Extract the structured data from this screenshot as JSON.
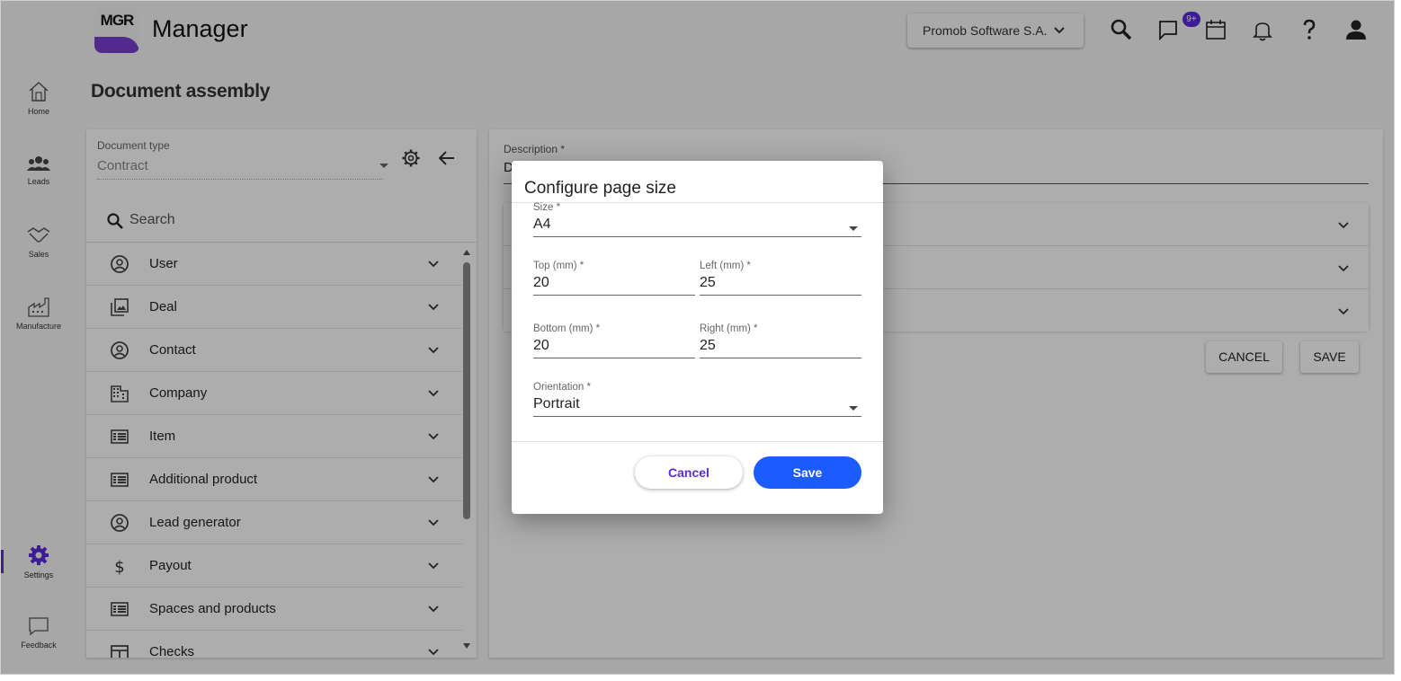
{
  "app": {
    "logo_text": "MGR",
    "title": "Manager"
  },
  "sidebar": {
    "items": [
      {
        "label": "Home",
        "icon": "home-icon"
      },
      {
        "label": "Leads",
        "icon": "people-icon"
      },
      {
        "label": "Sales",
        "icon": "handshake-icon"
      },
      {
        "label": "Manufacture",
        "icon": "factory-icon"
      },
      {
        "label": "Settings",
        "icon": "gear-icon",
        "active": true
      },
      {
        "label": "Feedback",
        "icon": "chat-bubble-icon"
      }
    ]
  },
  "topbar": {
    "company": "Promob Software S.A.",
    "notification_badge": "9+",
    "icons": [
      "search-icon",
      "chat-icon",
      "calendar-icon",
      "bell-icon",
      "help-icon",
      "account-icon"
    ]
  },
  "page": {
    "title": "Document assembly"
  },
  "left_panel": {
    "doc_type_label": "Document type",
    "doc_type_value": "Contract",
    "search_placeholder": "Search",
    "entities": [
      {
        "label": "User",
        "icon": "account-circle-icon"
      },
      {
        "label": "Deal",
        "icon": "image-stack-icon"
      },
      {
        "label": "Contact",
        "icon": "account-circle-icon"
      },
      {
        "label": "Company",
        "icon": "building-icon"
      },
      {
        "label": "Item",
        "icon": "list-icon"
      },
      {
        "label": "Additional product",
        "icon": "list-icon"
      },
      {
        "label": "Lead generator",
        "icon": "account-circle-icon"
      },
      {
        "label": "Payout",
        "icon": "dollar-icon"
      },
      {
        "label": "Spaces and products",
        "icon": "list-icon"
      },
      {
        "label": "Checks",
        "icon": "table-icon"
      }
    ]
  },
  "right_panel": {
    "description_label": "Description *",
    "description_value": "D",
    "cancel_label": "CANCEL",
    "save_label": "SAVE"
  },
  "modal": {
    "title": "Configure page size",
    "size_label": "Size *",
    "size_value": "A4",
    "top_label": "Top (mm) *",
    "top_value": "20",
    "left_label": "Left (mm) *",
    "left_value": "25",
    "bottom_label": "Bottom (mm) *",
    "bottom_value": "20",
    "right_label": "Right (mm) *",
    "right_value": "25",
    "orientation_label": "Orientation *",
    "orientation_value": "Portrait",
    "cancel_label": "Cancel",
    "save_label": "Save"
  },
  "colors": {
    "accent": "#5b2bd9",
    "primary_button": "#1a5cff"
  }
}
